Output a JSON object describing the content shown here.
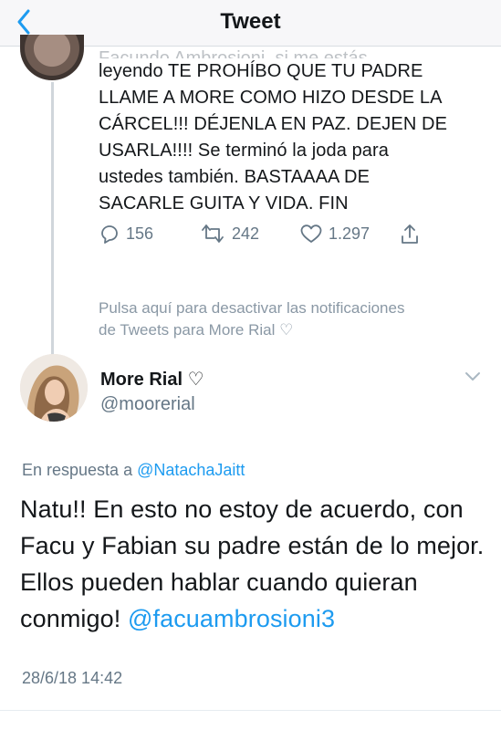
{
  "nav": {
    "title": "Tweet",
    "back_icon": "chevron-left-icon"
  },
  "tweet1": {
    "cutoff_line": "Facundo Ambrosioni, si me estás",
    "text": "leyendo TE PROHÍBO QUE TU PADRE\nLLAME A MORE COMO HIZO DESDE LA\nCÁRCEL!!! DÉJENLA EN PAZ. DEJEN DE\nUSARLA!!!! Se terminó la joda para\nustedes también. BASTAAAA DE\nSACARLE GUITA Y VIDA. FIN",
    "replies": "156",
    "retweets": "242",
    "likes": "1.297"
  },
  "mute_note": "Pulsa aquí para desactivar las notificaciones\nde Tweets para More Rial ♡",
  "tweet2": {
    "author_name": "More Rial ♡",
    "author_handle": "@moorerial",
    "reply_prefix": "En respuesta a",
    "reply_mention": "@NatachaJaitt",
    "text": "Natu!! En esto no estoy de acuerdo, con Facu y Fabian su padre están de lo mejor. Ellos pueden hablar cuando quieran conmigo!",
    "mention": "@facuambrosioni3",
    "timestamp": "28/6/18 14:42"
  },
  "colors": {
    "accent": "#1d9bf0",
    "muted": "#657786"
  }
}
